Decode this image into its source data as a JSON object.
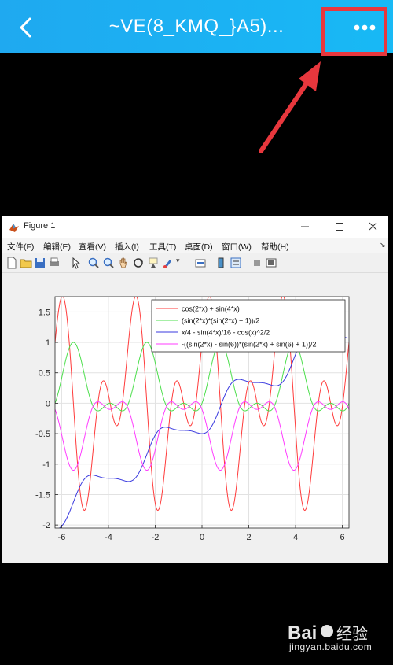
{
  "topbar": {
    "title": "~VE(8_KMQ_}A5)...",
    "back_icon": "chevron-left-icon",
    "more_icon": "more-dots-icon",
    "bg_color": "#1fa9f0"
  },
  "annotation": {
    "color": "#e8373d"
  },
  "figure_window": {
    "title": "Figure 1",
    "menu": [
      "文件(F)",
      "编辑(E)",
      "查看(V)",
      "插入(I)",
      "工具(T)",
      "桌面(D)",
      "窗口(W)",
      "帮助(H)"
    ]
  },
  "chart_data": {
    "type": "line",
    "title": "",
    "xlabel": "",
    "ylabel": "",
    "xlim": [
      -6.2832,
      6.2832
    ],
    "ylim": [
      -2.05,
      1.75
    ],
    "xticks": [
      "-6",
      "-4",
      "-2",
      "0",
      "2",
      "4",
      "6"
    ],
    "yticks": [
      "1.5",
      "1",
      "0.5",
      "0",
      "-0.5",
      "-1",
      "-1.5",
      "-2"
    ],
    "grid": true,
    "legend_position": "top-right",
    "series": [
      {
        "name": "cos(2*x) + sin(4*x)",
        "color": "#ff3b3b"
      },
      {
        "name": "(sin(2*x)*(sin(2*x) + 1))/2",
        "color": "#4ddf4d"
      },
      {
        "name": "x/4 - sin(4*x)/16 - cos(x)^2/2",
        "color": "#3a3adf"
      },
      {
        "name": "-((sin(2*x) - sin(6))*(sin(2*x) + sin(6) + 1))/2",
        "color": "#ff3bff"
      }
    ]
  },
  "watermark": {
    "site": "jingyan.baidu.com"
  }
}
